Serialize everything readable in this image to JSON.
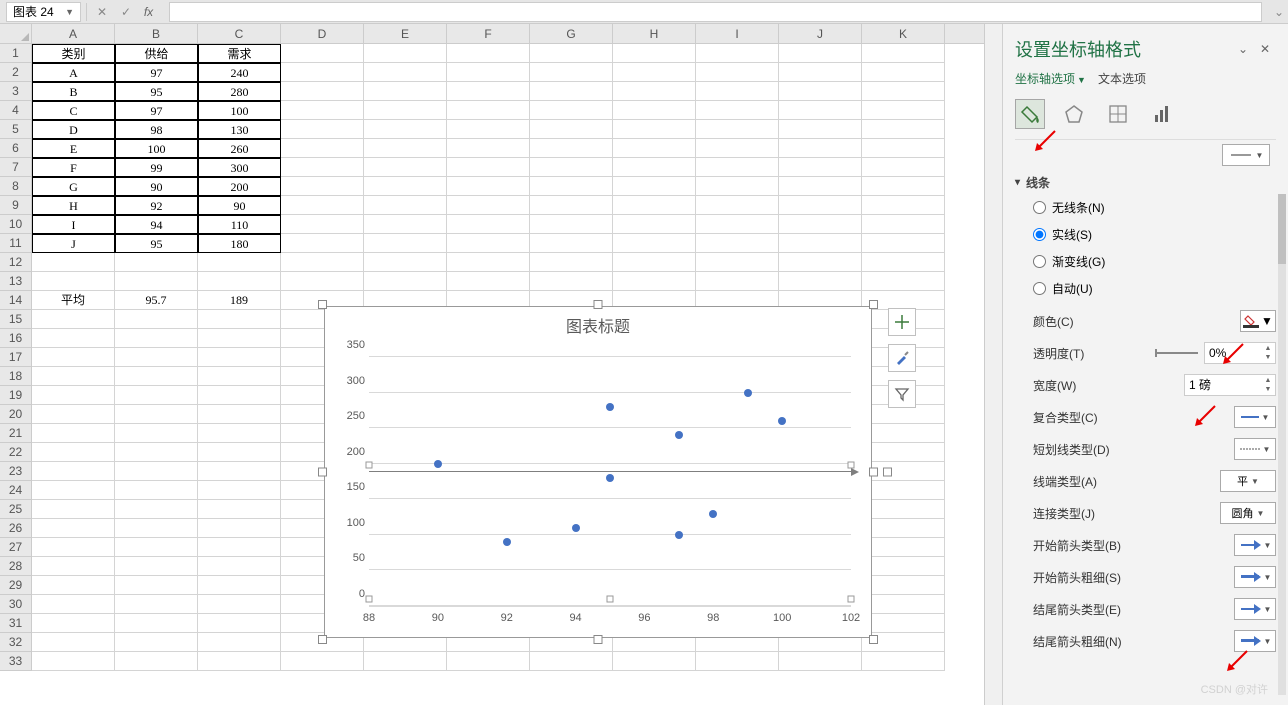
{
  "nameBox": "图表 24",
  "columns": [
    "A",
    "B",
    "C",
    "D",
    "E",
    "F",
    "G",
    "H",
    "I",
    "J",
    "K"
  ],
  "table": {
    "headers": [
      "类别",
      "供给",
      "需求"
    ],
    "rows": [
      [
        "A",
        "97",
        "240"
      ],
      [
        "B",
        "95",
        "280"
      ],
      [
        "C",
        "97",
        "100"
      ],
      [
        "D",
        "98",
        "130"
      ],
      [
        "E",
        "100",
        "260"
      ],
      [
        "F",
        "99",
        "300"
      ],
      [
        "G",
        "90",
        "200"
      ],
      [
        "H",
        "92",
        "90"
      ],
      [
        "I",
        "94",
        "110"
      ],
      [
        "J",
        "95",
        "180"
      ]
    ],
    "avgLabel": "平均",
    "avgSupply": "95.7",
    "avgDemand": "189"
  },
  "chart_data": {
    "type": "scatter",
    "title": "图表标题",
    "xlabel": "",
    "ylabel": "",
    "xlim": [
      88,
      102
    ],
    "ylim": [
      0,
      350
    ],
    "xticks": [
      88,
      90,
      92,
      94,
      96,
      98,
      100,
      102
    ],
    "yticks": [
      0,
      50,
      100,
      150,
      200,
      250,
      300,
      350
    ],
    "series": [
      {
        "name": "需求",
        "x": [
          97,
          95,
          97,
          98,
          100,
          99,
          90,
          92,
          94,
          95
        ],
        "y": [
          240,
          280,
          100,
          130,
          260,
          300,
          200,
          90,
          110,
          180
        ]
      }
    ],
    "hline_y": 189
  },
  "sideButtons": [
    "plus",
    "brush",
    "funnel"
  ],
  "panel": {
    "title": "设置坐标轴格式",
    "tabs": {
      "axis": "坐标轴选项",
      "text": "文本选项"
    },
    "section_line": "线条",
    "radios": {
      "none": "无线条(N)",
      "solid": "实线(S)",
      "gradient": "渐变线(G)",
      "auto": "自动(U)"
    },
    "selectedRadio": "solid",
    "props": {
      "color": "颜色(C)",
      "transparency": "透明度(T)",
      "transparency_val": "0%",
      "width": "宽度(W)",
      "width_val": "1 磅",
      "compound": "复合类型(C)",
      "dash": "短划线类型(D)",
      "cap": "线端类型(A)",
      "cap_val": "平",
      "join": "连接类型(J)",
      "join_val": "圆角",
      "beginArrowType": "开始箭头类型(B)",
      "beginArrowSize": "开始箭头粗细(S)",
      "endArrowType": "结尾箭头类型(E)",
      "endArrowSize": "结尾箭头粗细(N)"
    }
  },
  "watermark": "CSDN @对许"
}
